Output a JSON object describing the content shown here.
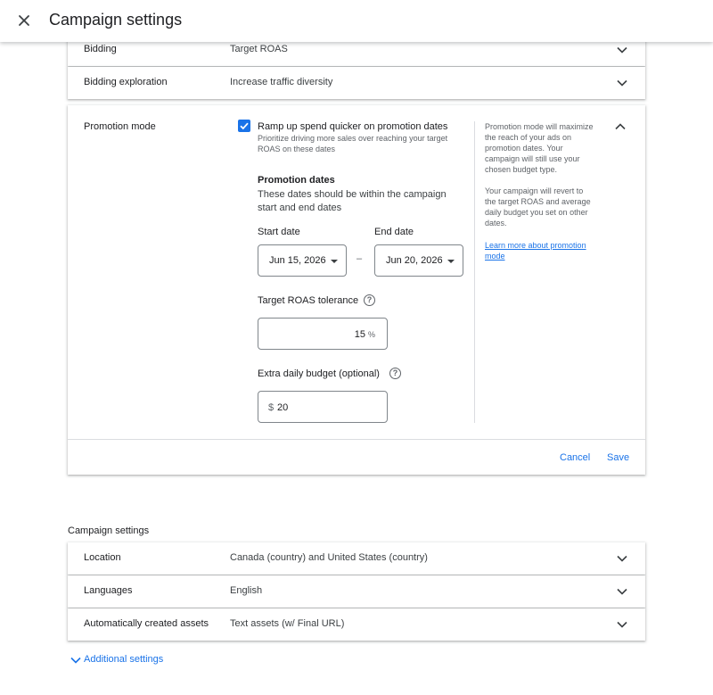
{
  "header": {
    "title": "Campaign settings"
  },
  "bid_rows": [
    {
      "label": "Bidding",
      "value": "Target ROAS"
    },
    {
      "label": "Bidding exploration",
      "value": "Increase traffic diversity"
    }
  ],
  "promotion": {
    "label": "Promotion mode",
    "checkbox_label": "Ramp up spend quicker on promotion dates",
    "checkbox_checked": true,
    "checkbox_desc_1": "Prioritize driving more sales over reaching your target",
    "checkbox_desc_2": "ROAS on these dates",
    "dates_title": "Promotion dates",
    "dates_desc_1": "These dates should be within the campaign",
    "dates_desc_2": "start and end dates",
    "start_label": "Start date",
    "end_label": "End date",
    "start_value": "Jun 15, 2026",
    "end_value": "Jun 20, 2026",
    "dash": "–",
    "tolerance_label": "Target ROAS tolerance",
    "tolerance_value": "15",
    "tolerance_suffix": "%",
    "budget_label": "Extra daily budget (optional)",
    "budget_prefix": "$",
    "budget_value": "20",
    "help_glyph": "?",
    "info_1": "Promotion mode will maximize",
    "info_2": "the reach of your ads on",
    "info_3": "promotion dates. Your",
    "info_4": "campaign will still use your",
    "info_5": "chosen budget type.",
    "info_6": "Your campaign will revert to",
    "info_7": "the target ROAS and average",
    "info_8": "daily budget you set on other",
    "info_9": "dates.",
    "learn_more_1": "Learn more about promotion",
    "learn_more_2": "mode",
    "cancel_label": "Cancel",
    "save_label": "Save"
  },
  "campaign_section": {
    "title": "Campaign settings",
    "rows": [
      {
        "label": "Location",
        "value": "Canada (country) and United States (country)"
      },
      {
        "label": "Languages",
        "value": "English"
      },
      {
        "label": "Automatically created assets",
        "value": "Text assets (w/ Final URL)"
      }
    ]
  },
  "additional": {
    "label": "Additional settings"
  },
  "colors": {
    "accent": "#1a73e8",
    "text": "#202124",
    "muted": "#5f6368",
    "border": "#dadce0"
  }
}
